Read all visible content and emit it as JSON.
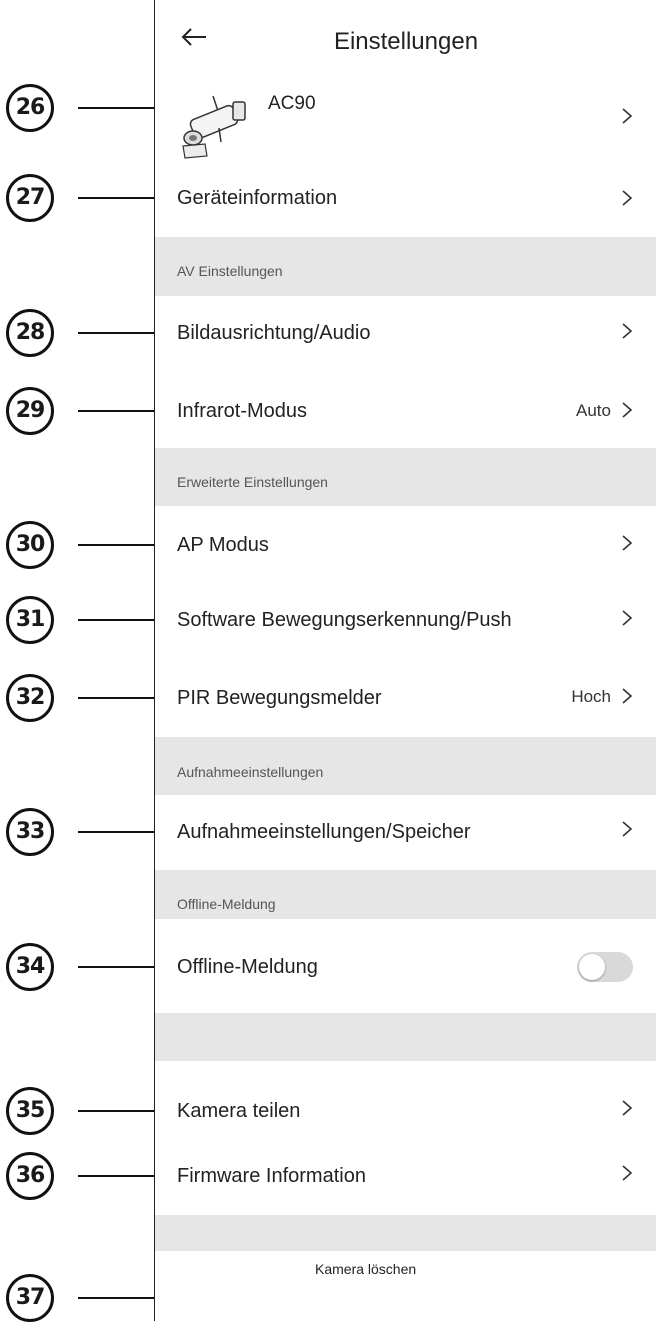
{
  "header": {
    "title": "Einstellungen"
  },
  "device": {
    "name": "AC90"
  },
  "rows": {
    "device_info": "Geräteinformation",
    "image_audio": "Bildausrichtung/Audio",
    "infrared": "Infrarot-Modus",
    "infrared_value": "Auto",
    "ap_mode": "AP Modus",
    "motion_push": "Software Bewegungserkennung/Push",
    "pir": "PIR Bewegungsmelder",
    "pir_value": "Hoch",
    "recording": "Aufnahmeeinstellungen/Speicher",
    "offline": "Offline-Meldung",
    "share": "Kamera teilen",
    "firmware": "Firmware Information"
  },
  "offline_toggle": {
    "on": false
  },
  "sections": {
    "av": "AV Einstellungen",
    "advanced": "Erweiterte Einstellungen",
    "recording": "Aufnahmeeinstellungen",
    "offline": "Offline-Meldung"
  },
  "delete_label": "Kamera löschen",
  "callouts": [
    "26",
    "27",
    "28",
    "29",
    "30",
    "31",
    "32",
    "33",
    "34",
    "35",
    "36",
    "37"
  ]
}
